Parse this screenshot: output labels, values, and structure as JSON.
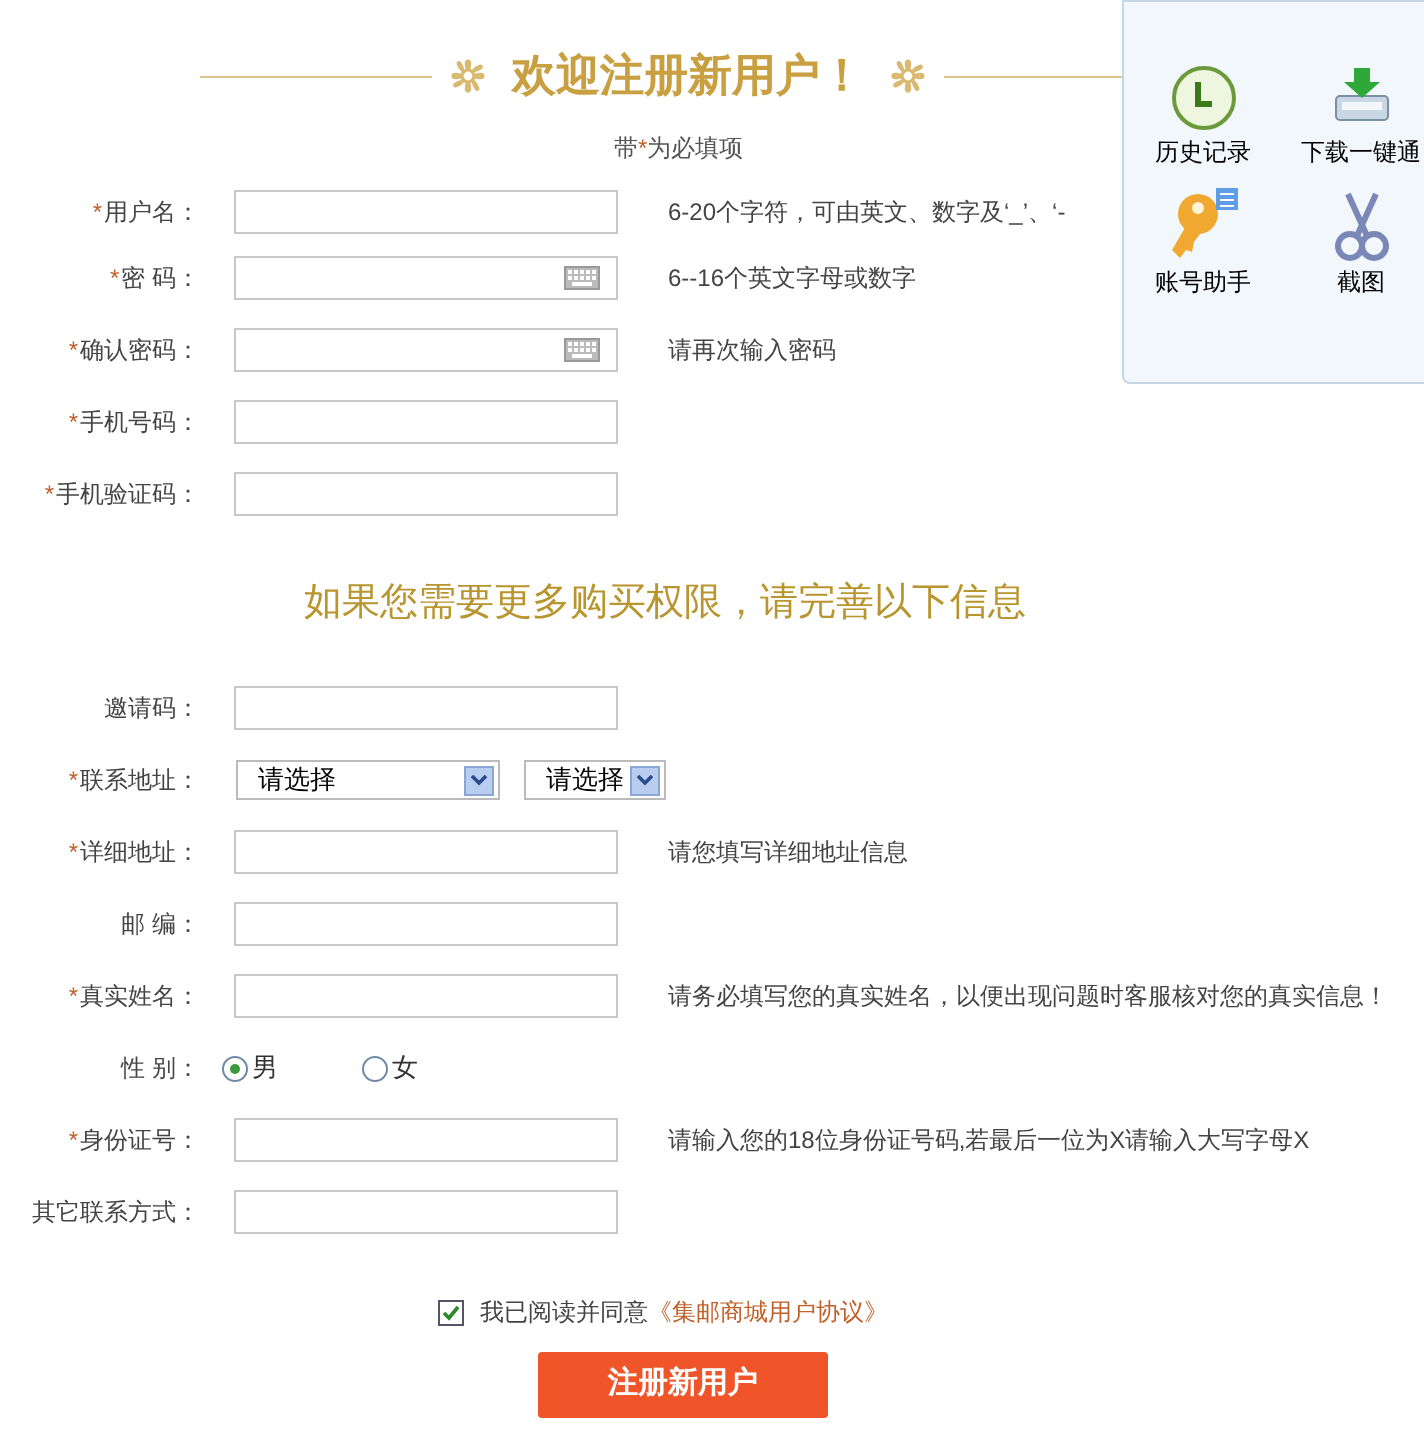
{
  "title": "欢迎注册新用户！",
  "required_note": {
    "prefix": "带",
    "mark": "*",
    "suffix": "为必填项"
  },
  "fields": [
    {
      "kind": "text",
      "label": "用户名：",
      "required": true,
      "hint": "6-20个字符，可由英文、数字及‘_’、‘-"
    },
    {
      "kind": "password",
      "label": "密 码：",
      "required": true,
      "hint": "6--16个英文字母或数字"
    },
    {
      "kind": "password",
      "label": "确认密码：",
      "required": true,
      "hint": "请再次输入密码"
    },
    {
      "kind": "text",
      "label": "手机号码：",
      "required": true
    },
    {
      "kind": "text",
      "label": "手机验证码：",
      "required": true
    }
  ],
  "section_heading": "如果您需要更多购买权限，请完善以下信息",
  "extra_fields": [
    {
      "kind": "text",
      "label": "邀请码：",
      "required": false
    },
    {
      "kind": "select",
      "label": "联系地址：",
      "required": true,
      "selects": [
        "请选择",
        "请选择"
      ]
    },
    {
      "kind": "text",
      "label": "详细地址：",
      "required": true,
      "hint": "请您填写详细地址信息"
    },
    {
      "kind": "text",
      "label": "邮 编：",
      "required": false
    },
    {
      "kind": "text",
      "label": "真实姓名：",
      "required": true,
      "hint": "请务必填写您的真实姓名，以便出现问题时客服核对您的真实信息！"
    },
    {
      "kind": "radio",
      "label": "性 别：",
      "required": false,
      "options": [
        {
          "label": "男",
          "selected": true
        },
        {
          "label": "女",
          "selected": false
        }
      ]
    },
    {
      "kind": "text",
      "label": "身份证号：",
      "required": true,
      "hint": "请输入您的18位身份证号码,若最后一位为X请输入大写字母X"
    },
    {
      "kind": "text",
      "label": "其它联系方式：",
      "required": false
    }
  ],
  "agreement": {
    "checked": true,
    "text": "我已阅读并同意",
    "link": "《集邮商城用户协议》"
  },
  "submit": "注册新用户",
  "popup_menu": {
    "items": [
      {
        "kind": "clock",
        "label": "历史记录"
      },
      {
        "kind": "download",
        "label": "下载一键通"
      },
      {
        "kind": "key",
        "label": "账号助手"
      },
      {
        "kind": "scissors",
        "label": "截图"
      }
    ]
  }
}
